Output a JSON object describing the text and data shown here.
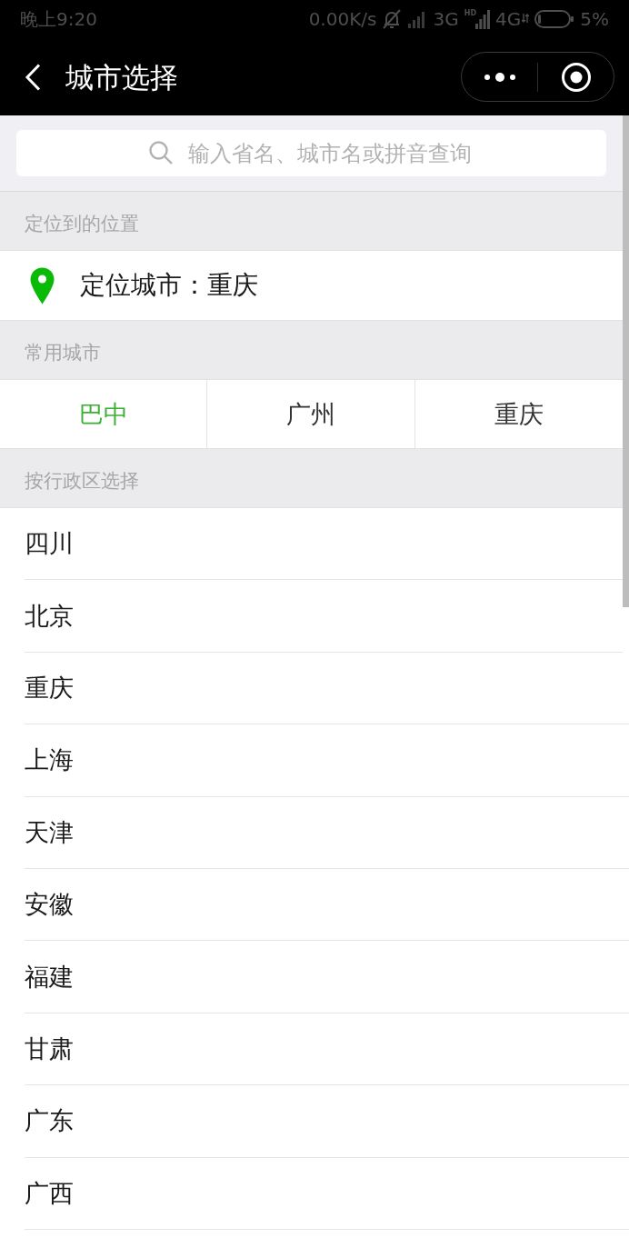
{
  "status_bar": {
    "time": "晚上9:20",
    "speed": "0.00K/s",
    "network_1": "3G",
    "hd_label": "HD",
    "network_2": "4G",
    "battery": "5%"
  },
  "nav_bar": {
    "title": "城市选择"
  },
  "search": {
    "placeholder": "输入省名、城市名或拼音查询"
  },
  "location": {
    "header": "定位到的位置",
    "text": "定位城市：重庆"
  },
  "frequent_cities": {
    "header": "常用城市",
    "items": [
      {
        "label": "巴中",
        "selected": true
      },
      {
        "label": "广州",
        "selected": false
      },
      {
        "label": "重庆",
        "selected": false
      }
    ]
  },
  "regions": {
    "header": "按行政区选择",
    "items": [
      "四川",
      "北京",
      "重庆",
      "上海",
      "天津",
      "安徽",
      "福建",
      "甘肃",
      "广东",
      "广西"
    ]
  }
}
